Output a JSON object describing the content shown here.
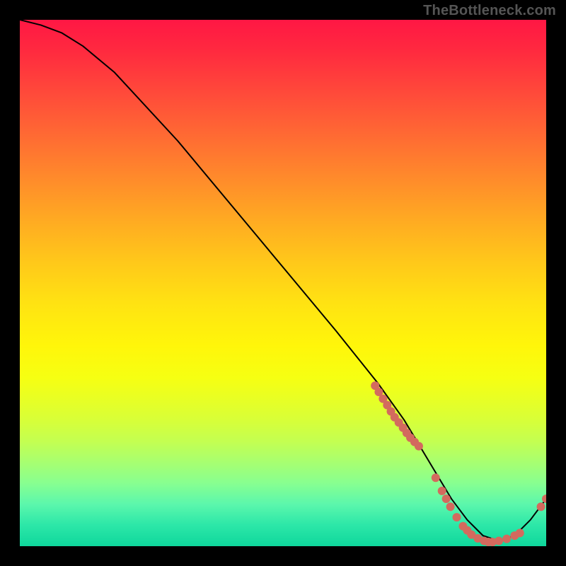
{
  "watermark": "TheBottleneck.com",
  "chart_data": {
    "type": "line",
    "title": "",
    "xlabel": "",
    "ylabel": "",
    "xlim": [
      0,
      100
    ],
    "ylim": [
      0,
      100
    ],
    "grid": false,
    "legend": false,
    "series": [
      {
        "name": "curve",
        "style": "line",
        "color": "#000000",
        "x": [
          0,
          4,
          8,
          12,
          18,
          30,
          45,
          60,
          68,
          73,
          76,
          79,
          82,
          85,
          88,
          91,
          94,
          97,
          100
        ],
        "y": [
          100,
          99,
          97.5,
          95,
          90,
          77,
          59,
          41,
          31,
          24,
          19,
          14,
          9,
          5,
          2,
          1,
          2,
          5,
          9
        ]
      },
      {
        "name": "upper-cluster",
        "style": "scatter",
        "color": "#d36a5e",
        "x": [
          67.5,
          68.2,
          69.0,
          69.8,
          70.5,
          71.2,
          72.0,
          72.8,
          73.5,
          74.2,
          75.0,
          75.8
        ],
        "y": [
          30.5,
          29.3,
          28.0,
          26.8,
          25.6,
          24.5,
          23.5,
          22.5,
          21.5,
          20.6,
          19.8,
          19.0
        ]
      },
      {
        "name": "valley-cluster",
        "style": "scatter",
        "color": "#d36a5e",
        "x": [
          79.0,
          80.2,
          81.0,
          81.8,
          83.0,
          84.2,
          85.0,
          85.8,
          87.0,
          88.2,
          89.0,
          89.8,
          91.0,
          92.5,
          94.0,
          95.0
        ],
        "y": [
          13.0,
          10.5,
          9.0,
          7.5,
          5.5,
          3.8,
          3.0,
          2.2,
          1.5,
          1.0,
          0.8,
          0.8,
          1.0,
          1.4,
          2.0,
          2.5
        ]
      },
      {
        "name": "right-tail",
        "style": "scatter",
        "color": "#d36a5e",
        "x": [
          99.0,
          100.0
        ],
        "y": [
          7.5,
          9.0
        ]
      }
    ]
  }
}
